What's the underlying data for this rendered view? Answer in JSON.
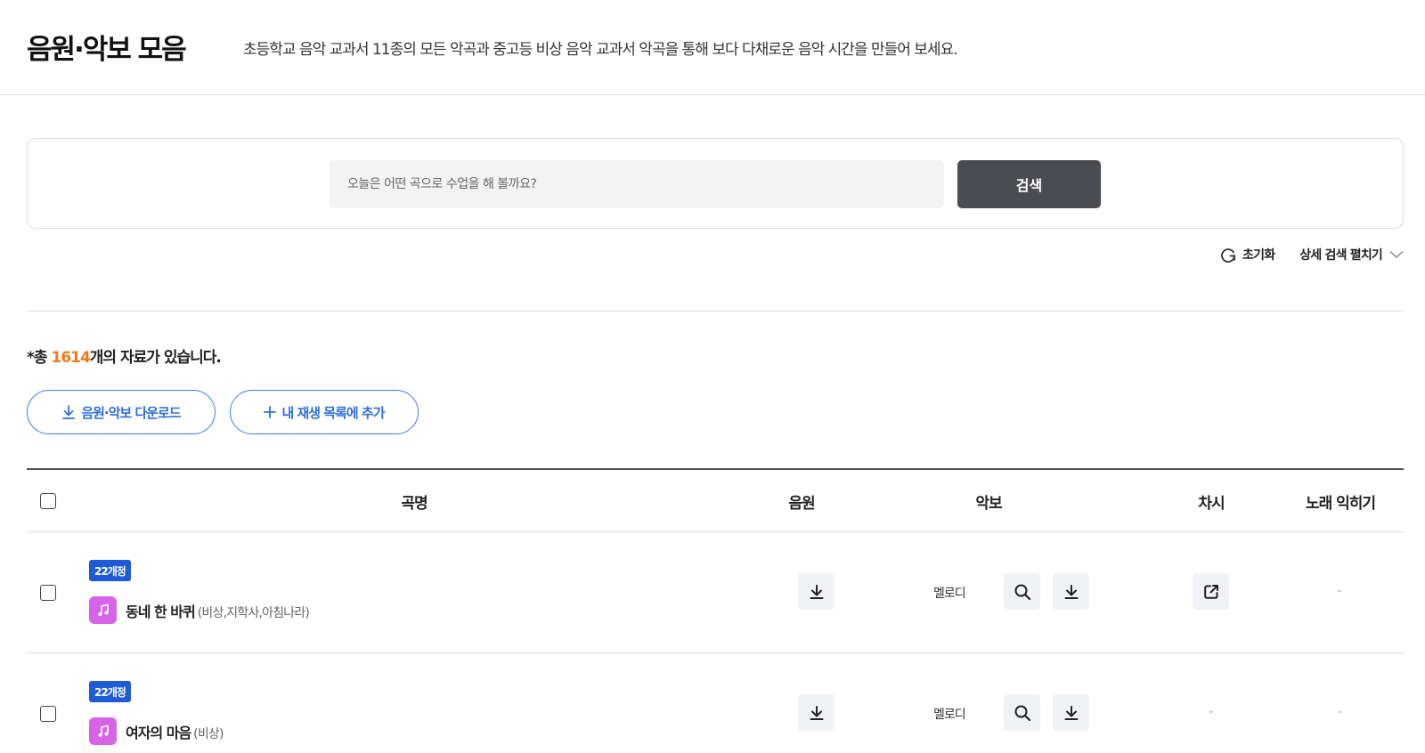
{
  "header": {
    "title": "음원·악보 모음",
    "description": "초등학교 음악 교과서 11종의 모든 악곡과 중고등 비상 음악 교과서 악곡을 통해 보다 다채로운 음악 시간을 만들어 보세요."
  },
  "search": {
    "placeholder": "오늘은 어떤 곡으로 수업을 해 볼까요?",
    "button_label": "검색"
  },
  "filters": {
    "reset_label": "초기화",
    "detail_label": "상세 검색 펼치기"
  },
  "results": {
    "prefix": "*총 ",
    "count": "1614",
    "suffix": "개의 자료가 있습니다."
  },
  "actions": {
    "download_label": "음원·악보 다운로드",
    "add_label": "내 재생 목록에 추가"
  },
  "table": {
    "headers": {
      "title": "곡명",
      "audio": "음원",
      "score": "악보",
      "lesson": "차시",
      "learn": "노래 익히기"
    },
    "rows": [
      {
        "badge": "22개정",
        "title": "동네 한 바퀴",
        "publishers": "(비상,지학사,아침나라)",
        "score_label": "멜로디",
        "learn": "-"
      },
      {
        "badge": "22개정",
        "title": "여자의 마음",
        "publishers": "(비상)",
        "score_label": "멜로디",
        "lesson": "-",
        "learn": "-"
      }
    ]
  },
  "icons": {
    "reset": "refresh-icon",
    "chevron": "chevron-down-icon",
    "download": "download-icon",
    "add": "plus-icon",
    "music": "music-note-icon",
    "search": "magnifier-icon",
    "external": "external-link-icon"
  },
  "colors": {
    "accent_blue": "#2f6fde",
    "badge_blue": "#1f5bd6",
    "count_orange": "#f07a1a",
    "search_button": "#4a4c52",
    "music_icon": "#d664e8"
  }
}
